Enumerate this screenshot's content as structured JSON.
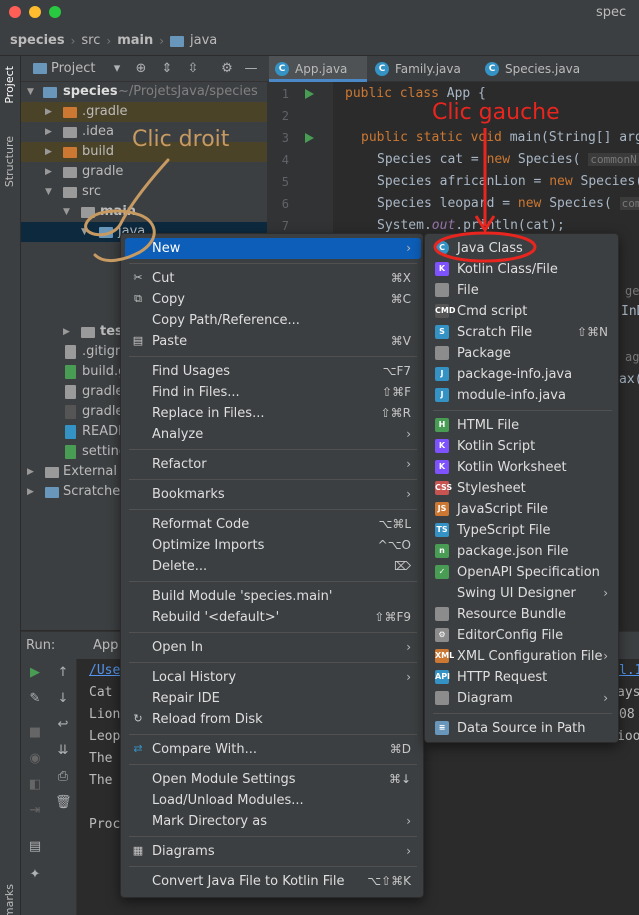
{
  "window": {
    "title": "spec"
  },
  "breadcrumb": [
    "species",
    "src",
    "main",
    "java"
  ],
  "side_tabs": {
    "project": "Project",
    "structure": "Structure",
    "bookmarks": "marks"
  },
  "project_panel": {
    "title": "Project",
    "tree": [
      {
        "label": "species",
        "hint": "~/ProjetsJava/species",
        "level": 0,
        "expanded": true,
        "icon": "folder-icon"
      },
      {
        "label": ".gradle",
        "level": 1,
        "expanded": false,
        "icon": "folder-icon"
      },
      {
        "label": ".idea",
        "level": 1,
        "expanded": false,
        "icon": "folder-icon"
      },
      {
        "label": "build",
        "level": 1,
        "expanded": false,
        "icon": "folder-icon"
      },
      {
        "label": "gradle",
        "level": 1,
        "expanded": false,
        "icon": "folder-icon"
      },
      {
        "label": "src",
        "level": 1,
        "expanded": true,
        "icon": "folder-icon"
      },
      {
        "label": "main",
        "level": 2,
        "expanded": true,
        "icon": "folder-icon"
      },
      {
        "label": "java",
        "level": 3,
        "expanded": true,
        "icon": "folder-icon"
      },
      {
        "label": "tes",
        "level": 2,
        "expanded": false,
        "icon": "folder-icon"
      },
      {
        "label": ".gitign",
        "level": 1,
        "icon": "file-icon"
      },
      {
        "label": "build.g",
        "level": 1,
        "icon": "gradle-icon"
      },
      {
        "label": "gradle",
        "level": 1,
        "icon": "file-icon"
      },
      {
        "label": "gradle",
        "level": 1,
        "icon": "bat-icon"
      },
      {
        "label": "READM",
        "level": 1,
        "icon": "markdown-icon"
      },
      {
        "label": "setting",
        "level": 1,
        "icon": "gradle-icon"
      },
      {
        "label": "External L",
        "level": 0,
        "expanded": false,
        "icon": "library-icon"
      },
      {
        "label": "Scratches",
        "level": 0,
        "expanded": false,
        "icon": "scratch-icon"
      }
    ]
  },
  "editor": {
    "tabs": [
      {
        "label": "App.java",
        "active": true
      },
      {
        "label": "Family.java",
        "active": false
      },
      {
        "label": "Species.java",
        "active": false
      }
    ],
    "line_numbers": [
      "1",
      "2",
      "3",
      "4",
      "5",
      "6",
      "7"
    ],
    "lines": {
      "l1_kw": "public class",
      "l1_rest": " App {",
      "l3_kw": "public static void",
      "l3_rest": " main(String[] arg",
      "l4_a": "Species cat = ",
      "l4_kw": "new",
      "l4_b": " Species( ",
      "l4_ph": "commonN",
      "l5_a": "Species africanLion = ",
      "l5_kw": "new",
      "l5_b": " Species(",
      "l6_a": "Species leopard = ",
      "l6_kw": "new",
      "l6_b": " Species( ",
      "l6_ph": "comm",
      "l7_a": "System.",
      "l7_it": "out",
      "l7_b": ".println(cat);"
    },
    "code_fragments": [
      "ge",
      "InD",
      "ag",
      "ax("
    ]
  },
  "run_panel": {
    "label": "Run:",
    "tab": "App",
    "console": [
      "/Use",
      "Cat",
      "Lion",
      "Leop",
      "The",
      "The",
      "",
      "Proc"
    ],
    "console_right": [
      "l.1",
      "ays",
      "08",
      "ioo"
    ]
  },
  "context_menu": {
    "items": [
      {
        "label": "New",
        "submenu": true,
        "active": true
      },
      {
        "sep": true
      },
      {
        "label": "Cut",
        "shortcut": "⌘X",
        "icon": "scissors-icon"
      },
      {
        "label": "Copy",
        "shortcut": "⌘C",
        "icon": "copy-icon"
      },
      {
        "label": "Copy Path/Reference..."
      },
      {
        "label": "Paste",
        "shortcut": "⌘V",
        "icon": "paste-icon"
      },
      {
        "sep": true
      },
      {
        "label": "Find Usages",
        "shortcut": "⌥F7"
      },
      {
        "label": "Find in Files...",
        "shortcut": "⇧⌘F"
      },
      {
        "label": "Replace in Files...",
        "shortcut": "⇧⌘R"
      },
      {
        "label": "Analyze",
        "submenu": true
      },
      {
        "sep": true
      },
      {
        "label": "Refactor",
        "submenu": true
      },
      {
        "sep": true
      },
      {
        "label": "Bookmarks",
        "submenu": true
      },
      {
        "sep": true
      },
      {
        "label": "Reformat Code",
        "shortcut": "⌥⌘L"
      },
      {
        "label": "Optimize Imports",
        "shortcut": "^⌥O"
      },
      {
        "label": "Delete...",
        "shortcut": "⌦"
      },
      {
        "sep": true
      },
      {
        "label": "Build Module 'species.main'"
      },
      {
        "label": "Rebuild '<default>'",
        "shortcut": "⇧⌘F9"
      },
      {
        "sep": true
      },
      {
        "label": "Open In",
        "submenu": true
      },
      {
        "sep": true
      },
      {
        "label": "Local History",
        "submenu": true
      },
      {
        "label": "Repair IDE"
      },
      {
        "label": "Reload from Disk",
        "icon": "reload-icon"
      },
      {
        "sep": true
      },
      {
        "label": "Compare With...",
        "shortcut": "⌘D",
        "icon": "compare-icon"
      },
      {
        "sep": true
      },
      {
        "label": "Open Module Settings",
        "shortcut": "⌘↓"
      },
      {
        "label": "Load/Unload Modules..."
      },
      {
        "label": "Mark Directory as",
        "submenu": true
      },
      {
        "sep": true
      },
      {
        "label": "Diagrams",
        "submenu": true,
        "icon": "diagram-icon"
      },
      {
        "sep": true
      },
      {
        "label": "Convert Java File to Kotlin File",
        "shortcut": "⌥⇧⌘K"
      }
    ]
  },
  "new_submenu": {
    "items": [
      {
        "label": "Java Class",
        "icon": "java-class-icon",
        "color": "#3592c4",
        "glyph": "C"
      },
      {
        "label": "Kotlin Class/File",
        "icon": "kotlin-icon",
        "color": "#7f52ff",
        "glyph": "K"
      },
      {
        "label": "File",
        "icon": "file-icon",
        "color": "#8c8c8c",
        "glyph": ""
      },
      {
        "label": "Cmd script",
        "icon": "cmd-icon",
        "color": "#555555",
        "glyph": "CMD"
      },
      {
        "label": "Scratch File",
        "shortcut": "⇧⌘N",
        "icon": "scratch-icon",
        "color": "#3592c4",
        "glyph": "S"
      },
      {
        "label": "Package",
        "icon": "package-icon",
        "color": "#8c8c8c",
        "glyph": ""
      },
      {
        "label": "package-info.java",
        "icon": "java-file-icon",
        "color": "#3592c4",
        "glyph": "J"
      },
      {
        "label": "module-info.java",
        "icon": "java-file-icon",
        "color": "#3592c4",
        "glyph": "J"
      },
      {
        "sep": true
      },
      {
        "label": "HTML File",
        "icon": "html-icon",
        "color": "#499c54",
        "glyph": "H"
      },
      {
        "label": "Kotlin Script",
        "icon": "kotlin-icon",
        "color": "#7f52ff",
        "glyph": "K"
      },
      {
        "label": "Kotlin Worksheet",
        "icon": "kotlin-icon",
        "color": "#7f52ff",
        "glyph": "K"
      },
      {
        "label": "Stylesheet",
        "icon": "css-icon",
        "color": "#c75450",
        "glyph": "CSS"
      },
      {
        "label": "JavaScript File",
        "icon": "js-icon",
        "color": "#cc7832",
        "glyph": "JS"
      },
      {
        "label": "TypeScript File",
        "icon": "ts-icon",
        "color": "#3592c4",
        "glyph": "TS"
      },
      {
        "label": "package.json File",
        "icon": "npm-icon",
        "color": "#499c54",
        "glyph": "n"
      },
      {
        "label": "OpenAPI Specification",
        "icon": "openapi-icon",
        "color": "#499c54",
        "glyph": "✓"
      },
      {
        "label": "Swing UI Designer",
        "submenu": true
      },
      {
        "label": "Resource Bundle",
        "icon": "bundle-icon",
        "color": "#8c8c8c",
        "glyph": ""
      },
      {
        "label": "EditorConfig File",
        "icon": "gear-icon",
        "color": "#8c8c8c",
        "glyph": "⚙"
      },
      {
        "label": "XML Configuration File",
        "submenu": true,
        "icon": "xml-icon",
        "color": "#cc7832",
        "glyph": "XML"
      },
      {
        "label": "HTTP Request",
        "icon": "http-icon",
        "color": "#3592c4",
        "glyph": "API"
      },
      {
        "label": "Diagram",
        "submenu": true,
        "icon": "diagram-icon",
        "color": "#8c8c8c",
        "glyph": ""
      },
      {
        "sep": true
      },
      {
        "label": "Data Source in Path",
        "icon": "database-icon",
        "color": "#6897bb",
        "glyph": "≡"
      }
    ]
  },
  "annotations": {
    "left": "Clic droit",
    "right": "Clic gauche"
  },
  "colors": {
    "accent": "#0d5eb8",
    "annotation_left": "#c79a62",
    "annotation_right": "#e8261f"
  }
}
